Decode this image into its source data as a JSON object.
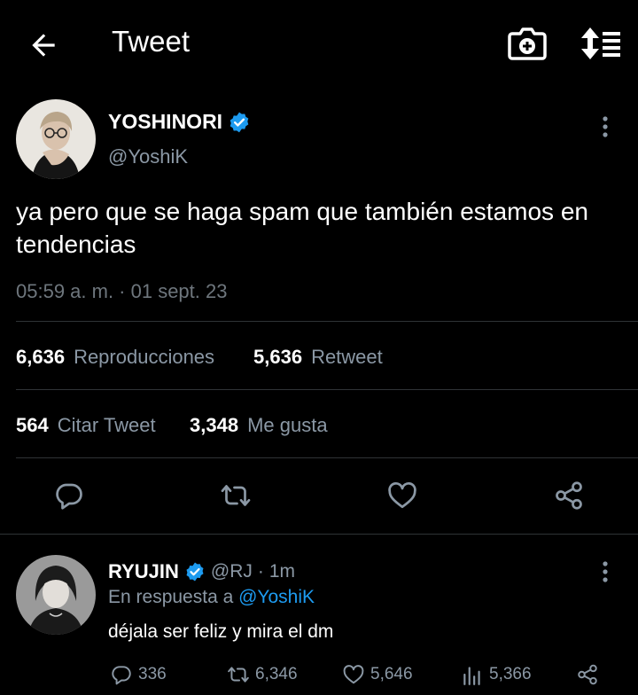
{
  "header": {
    "title": "Tweet",
    "icons": [
      "back-arrow-icon",
      "camera-add-icon",
      "sort-icon"
    ]
  },
  "tweet": {
    "name": "YOSHINORI",
    "handle": "@YoshiK",
    "text": "ya pero que se haga spam que también estamos en tendencias",
    "timestamp": "05:59 a. m. · 01 sept. 23",
    "stats": [
      {
        "count": "6,636",
        "label": "Reproducciones"
      },
      {
        "count": "5,636",
        "label": "Retweet"
      },
      {
        "count": "564",
        "label": "Citar Tweet"
      },
      {
        "count": "3,348",
        "label": "Me gusta"
      }
    ],
    "actions": [
      "reply-icon",
      "retweet-icon",
      "like-icon",
      "share-icon"
    ]
  },
  "reply": {
    "name": "RYUJIN",
    "handle": "@RJ",
    "time": "1m",
    "in_reply_prefix": "En respuesta a",
    "in_reply_handle": "@YoshiK",
    "text": "déjala ser feliz y mira el dm",
    "counts": {
      "replies": "336",
      "retweets": "6,346",
      "likes": "5,646",
      "views": "5,366"
    }
  },
  "colors": {
    "background": "#000000",
    "text": "#e7e9ea",
    "muted": "#8b98a5",
    "accent": "#1d9bf0",
    "divider": "#2f3336"
  }
}
